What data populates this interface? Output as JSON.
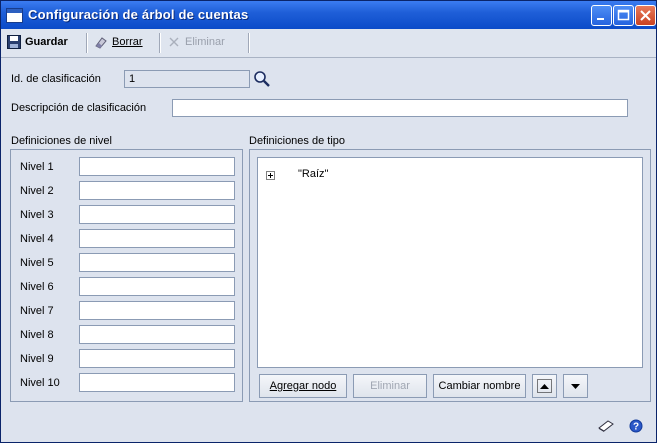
{
  "window": {
    "title": "Configuración de árbol de cuentas"
  },
  "toolbar": {
    "save_label": "Guardar",
    "clear_label": "Borrar",
    "delete_label": "Eliminar"
  },
  "form": {
    "classification_id_label": "Id. de clasificación",
    "classification_id_value": "1",
    "classification_desc_label": "Descripción de clasificación",
    "classification_desc_value": ""
  },
  "levels": {
    "heading": "Definiciones de nivel",
    "items": [
      {
        "label": "Nivel 1",
        "value": ""
      },
      {
        "label": "Nivel 2",
        "value": ""
      },
      {
        "label": "Nivel 3",
        "value": ""
      },
      {
        "label": "Nivel 4",
        "value": ""
      },
      {
        "label": "Nivel 5",
        "value": ""
      },
      {
        "label": "Nivel 6",
        "value": ""
      },
      {
        "label": "Nivel 7",
        "value": ""
      },
      {
        "label": "Nivel 8",
        "value": ""
      },
      {
        "label": "Nivel 9",
        "value": ""
      },
      {
        "label": "Nivel 10",
        "value": ""
      }
    ]
  },
  "types": {
    "heading": "Definiciones de tipo",
    "tree_root": "\"Raíz\"",
    "add_node_label": "Agregar nodo",
    "delete_label": "Eliminar",
    "rename_label": "Cambiar nombre"
  },
  "colors": {
    "titlebar": "#1f5fd8",
    "window_bg": "#dde3ee",
    "border": "#8b9bb4"
  }
}
